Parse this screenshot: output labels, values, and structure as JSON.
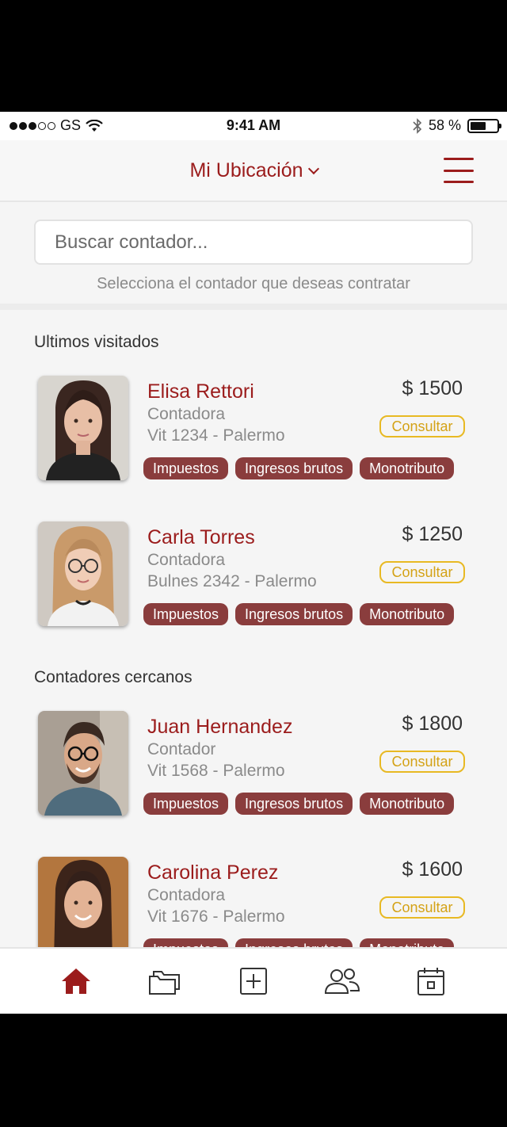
{
  "status_bar": {
    "carrier": "GS",
    "time": "9:41 AM",
    "battery_text": "58 %",
    "battery_level": 0.58
  },
  "header": {
    "title": "Mi Ubicación",
    "menu_icon": "hamburger-menu-icon"
  },
  "search": {
    "placeholder": "Buscar contador...",
    "hint": "Selecciona el contador que deseas contratar"
  },
  "sections": {
    "recent": "Ultimos visitados",
    "nearby": "Contadores cercanos"
  },
  "accountants": [
    {
      "name": "Elisa Rettori",
      "role": "Contadora",
      "address": "Vit 1234 - Palermo",
      "price": "$ 1500",
      "action": "Consultar",
      "tags": [
        "Impuestos",
        "Ingresos brutos",
        "Monotributo"
      ]
    },
    {
      "name": "Carla Torres",
      "role": "Contadora",
      "address": "Bulnes 2342 - Palermo",
      "price": "$ 1250",
      "action": "Consultar",
      "tags": [
        "Impuestos",
        "Ingresos brutos",
        "Monotributo"
      ]
    },
    {
      "name": "Juan Hernandez",
      "role": "Contador",
      "address": "Vit 1568 - Palermo",
      "price": "$ 1800",
      "action": "Consultar",
      "tags": [
        "Impuestos",
        "Ingresos brutos",
        "Monotributo"
      ]
    },
    {
      "name": "Carolina Perez",
      "role": "Contadora",
      "address": "Vit 1676 - Palermo",
      "price": "$ 1600",
      "action": "Consultar",
      "tags": [
        "Impuestos",
        "Ingresos brutos",
        "Monotributo"
      ]
    }
  ],
  "nav": {
    "items": [
      "home-icon",
      "folder-icon",
      "add-square-icon",
      "users-icon",
      "calendar-icon"
    ],
    "active": "home-icon"
  },
  "colors": {
    "brand": "#9b1c1c",
    "tag_bg": "#8a3d3d",
    "consult": "#e8b923",
    "muted": "#8a8a8a"
  }
}
